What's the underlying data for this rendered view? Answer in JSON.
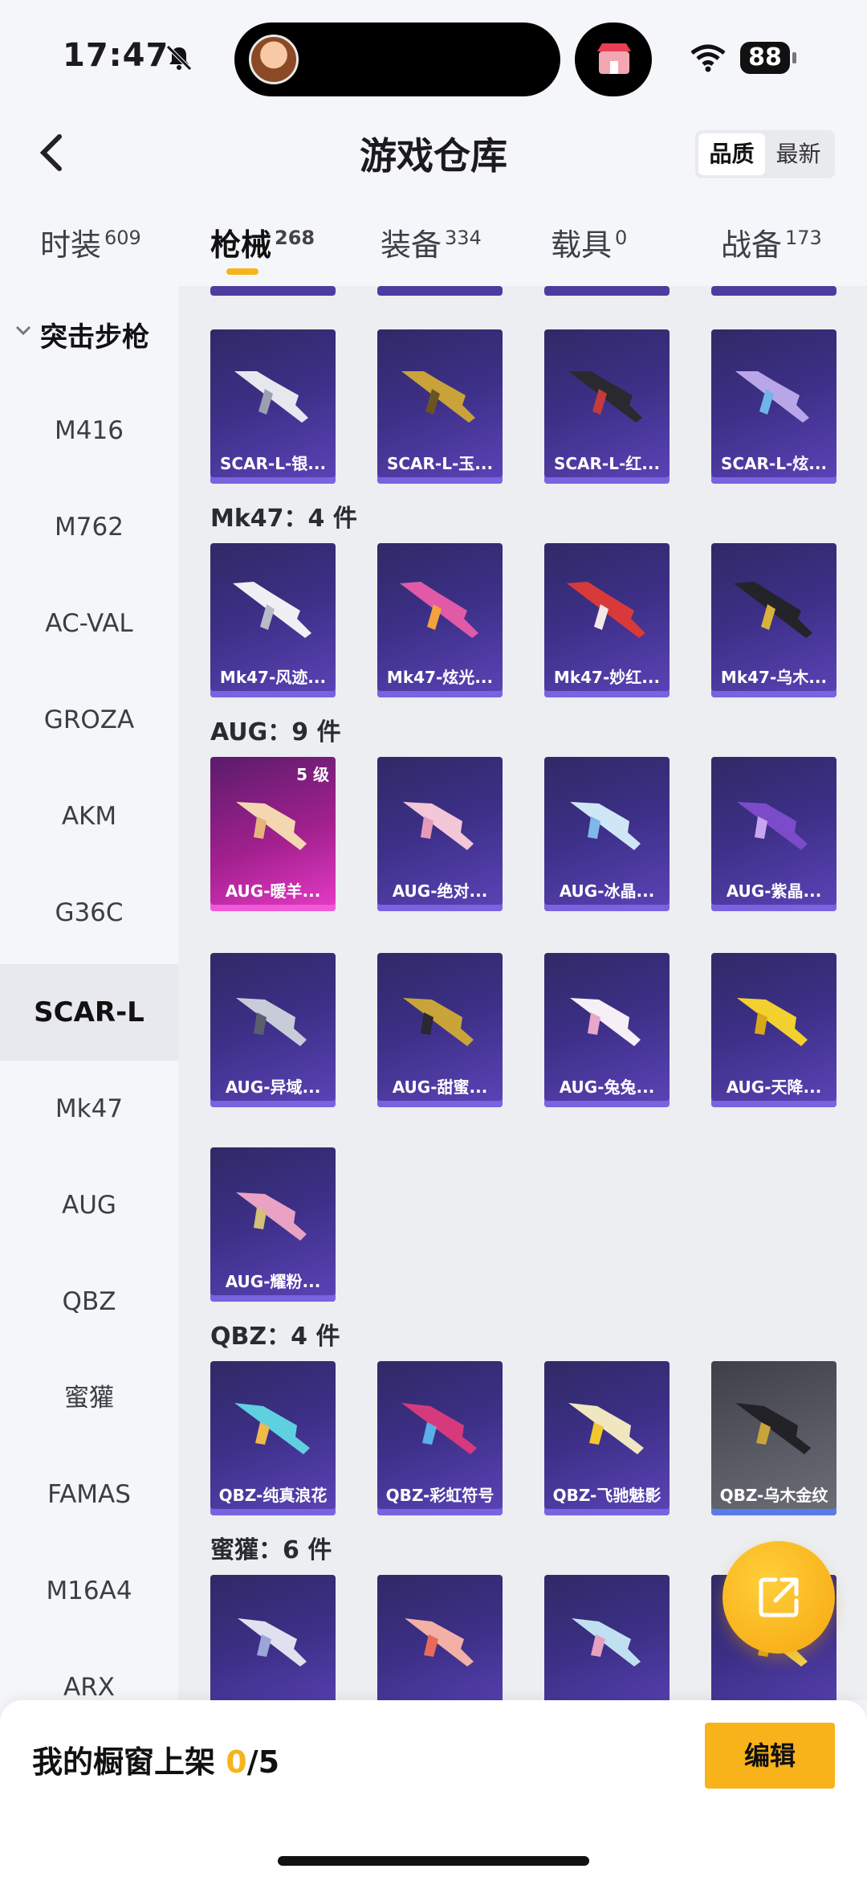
{
  "status": {
    "time": "17:47",
    "battery": "88"
  },
  "header": {
    "title": "游戏仓库",
    "sort": [
      "品质",
      "最新"
    ]
  },
  "tabs": [
    {
      "label": "时装",
      "count": "609"
    },
    {
      "label": "枪械",
      "count": "268"
    },
    {
      "label": "装备",
      "count": "334"
    },
    {
      "label": "载具",
      "count": "0"
    },
    {
      "label": "战备",
      "count": "173"
    }
  ],
  "sidebar": {
    "group": "突击步枪",
    "items": [
      "M416",
      "M762",
      "AC-VAL",
      "GROZA",
      "AKM",
      "G36C",
      "SCAR-L",
      "Mk47",
      "AUG",
      "QBZ",
      "蜜獾",
      "FAMAS",
      "M16A4",
      "ARX"
    ],
    "active": "SCAR-L"
  },
  "sections": {
    "scar": {
      "items": [
        "SCAR-L-银...",
        "SCAR-L-玉...",
        "SCAR-L-红...",
        "SCAR-L-炫..."
      ]
    },
    "mk47": {
      "label": "Mk47：4 件",
      "items": [
        "Mk47-风迹...",
        "Mk47-炫光...",
        "Mk47-妙红...",
        "Mk47-乌木..."
      ]
    },
    "aug": {
      "label": "AUG：9 件",
      "level": "5 级",
      "items": [
        "AUG-暖羊...",
        "AUG-绝对...",
        "AUG-冰晶...",
        "AUG-紫晶...",
        "AUG-异域...",
        "AUG-甜蜜...",
        "AUG-兔兔...",
        "AUG-天降...",
        "AUG-耀粉..."
      ]
    },
    "qbz": {
      "label": "QBZ：4 件",
      "items": [
        "QBZ-纯真浪花",
        "QBZ-彩虹符号",
        "QBZ-飞驰魅影",
        "QBZ-乌木金纹"
      ]
    },
    "honey": {
      "label": "蜜獾：6 件"
    }
  },
  "bottom": {
    "shelf_label": "我的橱窗上架 ",
    "shelf_count": "0",
    "shelf_total": "/5",
    "edit": "编辑"
  },
  "colors": {
    "accent": "#f6b41c",
    "card_purple": "#3c2f86",
    "card_pink": "#d42fb5"
  }
}
